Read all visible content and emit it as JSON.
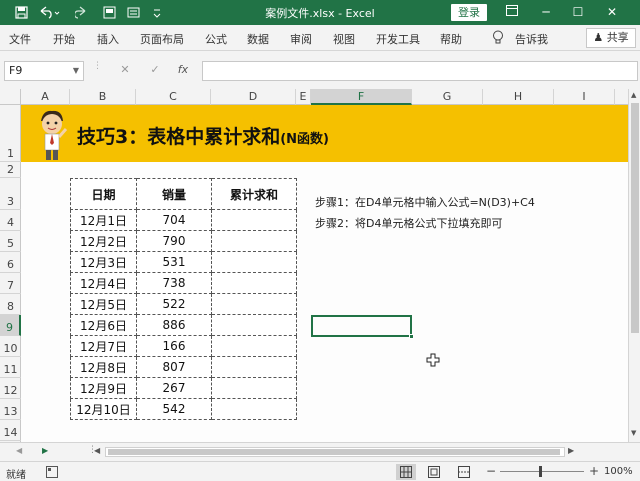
{
  "titlebar": {
    "title": "案例文件.xlsx  -  Excel",
    "login": "登录",
    "save_icon": "save-icon",
    "undo_icon": "undo-icon",
    "redo_icon": "redo-icon"
  },
  "ribbon": {
    "tabs": [
      "文件",
      "开始",
      "插入",
      "页面布局",
      "公式",
      "数据",
      "审阅",
      "视图",
      "开发工具",
      "帮助"
    ],
    "tell_me": "告诉我",
    "share": "共享"
  },
  "formula_bar": {
    "name_box": "F9",
    "cancel": "✕",
    "enter": "✓",
    "fx": "fx",
    "formula": ""
  },
  "columns": [
    "A",
    "B",
    "C",
    "D",
    "E",
    "F",
    "G",
    "H",
    "I"
  ],
  "rows": [
    "1",
    "2",
    "3",
    "4",
    "5",
    "6",
    "7",
    "8",
    "9",
    "10",
    "11",
    "12",
    "13",
    "14"
  ],
  "banner": {
    "title": "技巧3：表格中累计求和",
    "subtitle": "(N函数)"
  },
  "table": {
    "headers": [
      "日期",
      "销量",
      "累计求和"
    ],
    "rows": [
      [
        "12月1日",
        "704",
        ""
      ],
      [
        "12月2日",
        "790",
        ""
      ],
      [
        "12月3日",
        "531",
        ""
      ],
      [
        "12月4日",
        "738",
        ""
      ],
      [
        "12月5日",
        "522",
        ""
      ],
      [
        "12月6日",
        "886",
        ""
      ],
      [
        "12月7日",
        "166",
        ""
      ],
      [
        "12月8日",
        "807",
        ""
      ],
      [
        "12月9日",
        "267",
        ""
      ],
      [
        "12月10日",
        "542",
        ""
      ]
    ]
  },
  "notes": {
    "step1": "步骤1：在D4单元格中输入公式=N(D3)+C4",
    "step2": "步骤2：将D4单元格公式下拉填充即可"
  },
  "status": {
    "ready": "就绪",
    "zoom": "100%"
  },
  "colors": {
    "excel_green": "#217346",
    "banner_yellow": "#f5c000"
  }
}
